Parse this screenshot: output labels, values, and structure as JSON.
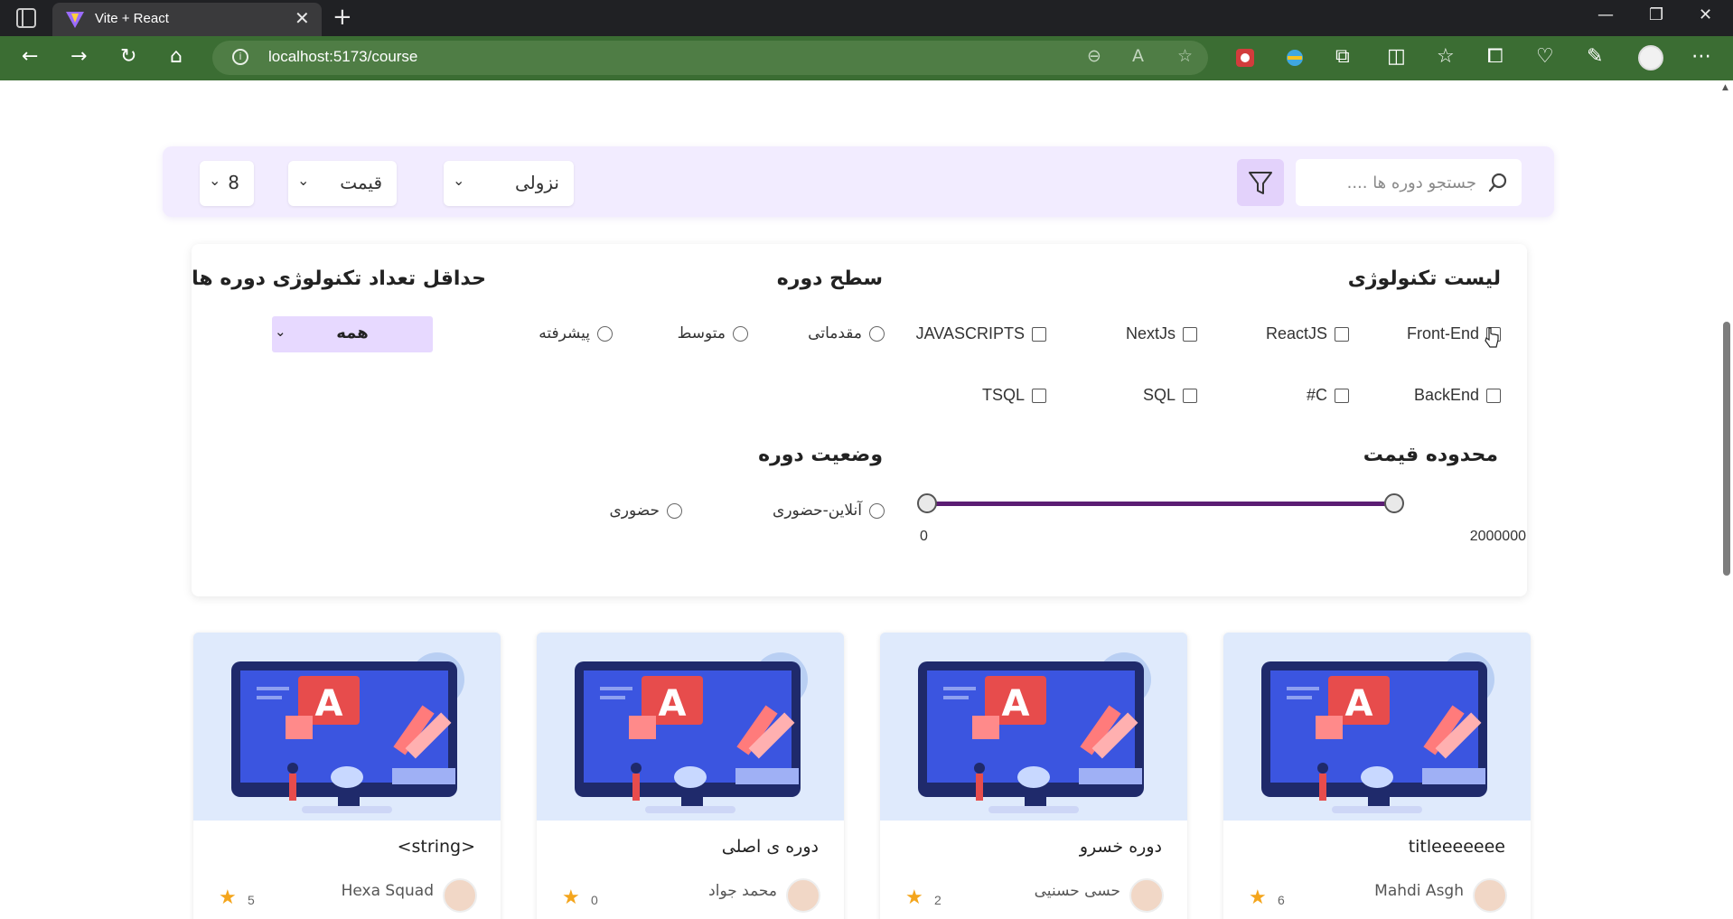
{
  "browser": {
    "tab_title": "Vite + React",
    "url": "localhost:5173/course"
  },
  "toolbar": {
    "search_placeholder": "جستجو دوره ها ....",
    "sort_direction": "نزولی",
    "sort_by": "قیمت",
    "page_size": "8"
  },
  "filters": {
    "tech_title": "لیست تکنولوژی",
    "tech_items": [
      "Front-End",
      "ReactJS",
      "NextJs",
      "JAVASCRIPTS",
      "BackEnd",
      "#C",
      "SQL",
      "TSQL"
    ],
    "level_title": "سطح دوره",
    "level_items": [
      "مقدماتی",
      "متوسط",
      "پیشرفته"
    ],
    "min_tech_title": "حداقل تعداد تکنولوژی دوره ها",
    "min_tech_value": "همه",
    "price_title": "محدوده قیمت",
    "price_min": "0",
    "price_max": "2000000",
    "status_title": "وضعیت دوره",
    "status_items": [
      "آنلاین-حضوری",
      "حضوری"
    ]
  },
  "courses": [
    {
      "title": "titleeeeeee",
      "author": "Mahdi Asgh",
      "rating": "6"
    },
    {
      "title": "دوره خسرو",
      "author": "حسی حسنیی",
      "rating": "2"
    },
    {
      "title": "دوره ی اصلی",
      "author": "محمد جواد",
      "rating": "0"
    },
    {
      "title": "<string>",
      "author": "Hexa Squad",
      "rating": "5"
    }
  ],
  "colors": {
    "accent": "#5b1d73",
    "toolbar_bg": "#f2ecff",
    "star": "#f4a51c",
    "address_bar": "#3b6d33"
  }
}
